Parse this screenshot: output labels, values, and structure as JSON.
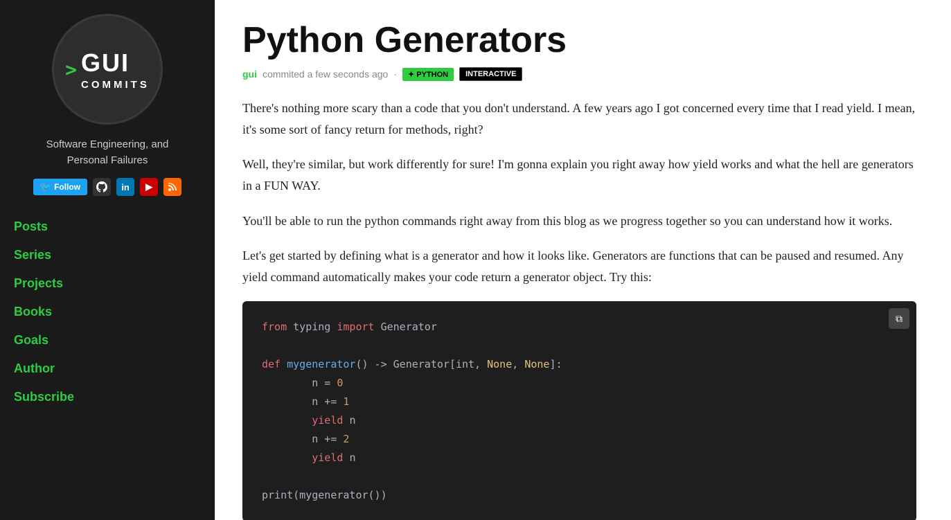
{
  "sidebar": {
    "logo_arrow": ">",
    "logo_text": "GUI",
    "logo_sub": "COMMITS",
    "tagline_line1": "Software Engineering, and",
    "tagline_line2": "Personal Failures",
    "follow_label": "Follow",
    "nav_items": [
      {
        "id": "posts",
        "label": "Posts"
      },
      {
        "id": "series",
        "label": "Series"
      },
      {
        "id": "projects",
        "label": "Projects"
      },
      {
        "id": "books",
        "label": "Books"
      },
      {
        "id": "goals",
        "label": "Goals"
      },
      {
        "id": "author",
        "label": "Author"
      },
      {
        "id": "subscribe",
        "label": "Subscribe"
      }
    ]
  },
  "post": {
    "title": "Python Generators",
    "author": "gui",
    "time": "commited a few seconds ago",
    "badge_python": "✦ PYTHON",
    "badge_interactive": "INTERACTIVE",
    "paragraph1": "There's nothing more scary than a code that you don't understand. A few years ago I got concerned every time that I read yield. I mean, it's some sort of fancy return for methods, right?",
    "paragraph2": "Well, they're similar, but work differently for sure! I'm gonna explain you right away how yield works and what the hell are generators in a FUN WAY.",
    "paragraph3": "You'll be able to run the python commands right away from this blog as we progress together so you can understand how it works.",
    "paragraph4": "Let's get started by defining what is a generator and how it looks like. Generators are functions that can be paused and resumed. Any yield command automatically makes your code return a generator object. Try this:",
    "copy_icon": "⧉"
  },
  "code": {
    "lines": [
      {
        "text": "from typing import Generator",
        "type": "import_line"
      },
      {
        "text": "",
        "type": "empty"
      },
      {
        "text": "def mygenerator() -> Generator[int, None, None]:",
        "type": "def_line"
      },
      {
        "text": "        n = 0",
        "type": "assign"
      },
      {
        "text": "        n += 1",
        "type": "assign"
      },
      {
        "text": "        yield n",
        "type": "yield"
      },
      {
        "text": "        n += 2",
        "type": "assign"
      },
      {
        "text": "        yield n",
        "type": "yield"
      },
      {
        "text": "",
        "type": "empty"
      },
      {
        "text": "print(mygenerator())",
        "type": "print"
      }
    ]
  }
}
